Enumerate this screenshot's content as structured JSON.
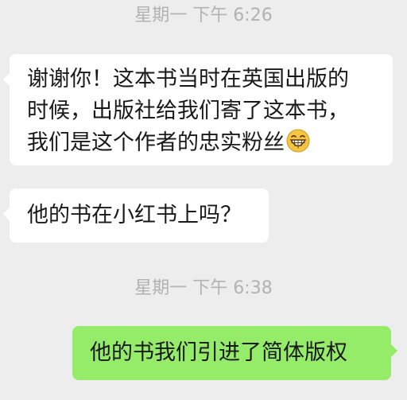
{
  "timestamps": {
    "first": "星期一 下午 6:26",
    "second": "星期一 下午 6:38"
  },
  "messages": [
    {
      "direction": "incoming",
      "lines": [
        "谢谢你！这本书当时在英国出版的",
        "时候，出版社给我们寄了这本书，",
        "我们是这个作者的忠实粉丝"
      ],
      "emoji": "grinning-face-emoji"
    },
    {
      "direction": "incoming",
      "text": "他的书在小红书上吗？"
    },
    {
      "direction": "outgoing",
      "text": "他的书我们引进了简体版权"
    }
  ],
  "colors": {
    "background": "#ededed",
    "incoming_bubble": "#ffffff",
    "outgoing_bubble": "#95ec69",
    "timestamp_text": "#b2b2b2",
    "message_text": "#191919"
  }
}
